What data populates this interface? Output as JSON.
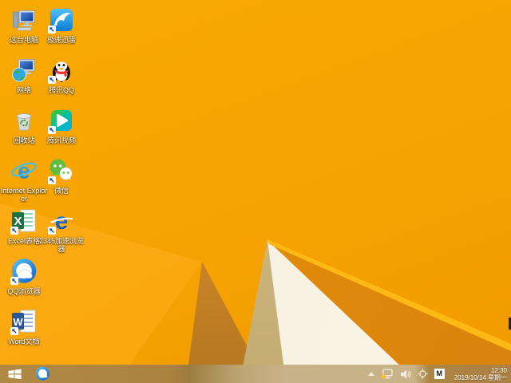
{
  "desktop": {
    "icons": [
      {
        "id": "this-pc",
        "label": "这台电脑",
        "art": "computer",
        "col": 1,
        "row": 1,
        "shortcut": false
      },
      {
        "id": "thunder",
        "label": "极速迅雷",
        "art": "thunder",
        "col": 2,
        "row": 1,
        "shortcut": true
      },
      {
        "id": "network",
        "label": "网络",
        "art": "network",
        "col": 1,
        "row": 2,
        "shortcut": false
      },
      {
        "id": "tencent-qq",
        "label": "腾讯QQ",
        "art": "qq",
        "col": 2,
        "row": 2,
        "shortcut": true
      },
      {
        "id": "recycle-bin",
        "label": "回收站",
        "art": "recycle",
        "col": 1,
        "row": 3,
        "shortcut": false
      },
      {
        "id": "tencent-video",
        "label": "腾讯视频",
        "art": "tvideo",
        "col": 2,
        "row": 3,
        "shortcut": true
      },
      {
        "id": "internet-explorer",
        "label": "Internet Explorer",
        "art": "ie",
        "col": 1,
        "row": 4,
        "shortcut": false
      },
      {
        "id": "wechat",
        "label": "微信",
        "art": "wechat",
        "col": 2,
        "row": 4,
        "shortcut": true
      },
      {
        "id": "excel",
        "label": "Excel表格",
        "art": "excel",
        "col": 1,
        "row": 5,
        "shortcut": true
      },
      {
        "id": "browser-2345",
        "label": "2345加速浏览器",
        "art": "e2345",
        "col": 2,
        "row": 5,
        "shortcut": true
      },
      {
        "id": "qq-browser",
        "label": "QQ浏览器",
        "art": "qqbrowser",
        "col": 1,
        "row": 6,
        "shortcut": true
      },
      {
        "id": "word",
        "label": "Word文档",
        "art": "word",
        "col": 1,
        "row": 7,
        "shortcut": true
      }
    ]
  },
  "taskbar": {
    "start_tooltip": "开始",
    "pinned": [
      {
        "id": "qq-browser",
        "art": "qqbrowser"
      }
    ],
    "tray": {
      "icon_names": [
        "hidden-icons-expander",
        "network-status-warning",
        "volume",
        "pointer-target",
        "ime-indicator"
      ],
      "ime_label": "M",
      "clock": {
        "time": "12:30",
        "date": "2019/10/14 星期一"
      }
    }
  },
  "colors": {
    "wallpaper_orange": "#f6a302",
    "wallpaper_bright_wedge": "#fdae17",
    "wallpaper_shadow_brown": "#b4761f",
    "wallpaper_khaki": "#c8b37b",
    "wallpaper_cream": "#f7f2e3",
    "wallpaper_ridge": "#ffb915",
    "taskbar_tint": "#ab8340",
    "label_text": "#ffffff"
  }
}
